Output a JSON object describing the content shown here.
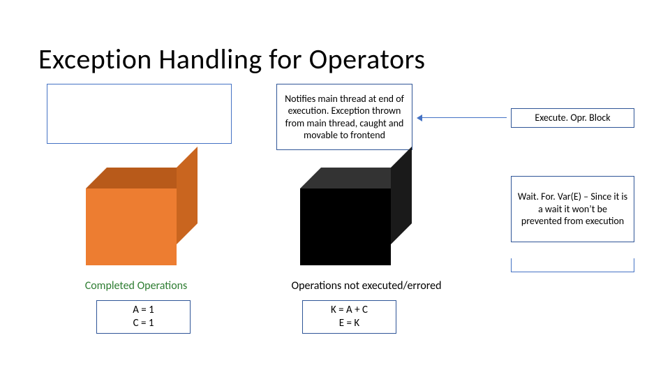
{
  "title": "Exception Handling for Operators",
  "notifies": "Notifies main thread at end of execution. Exception thrown from main thread, caught and movable to frontend",
  "execute": "Execute. Opr. Block",
  "wait": "Wait. For. Var(E) – Since it is a wait it won’t be prevented from execution",
  "labels": {
    "completed": "Completed Operations",
    "notexec": "Operations not executed/errored"
  },
  "code": {
    "ac_line1": "A = 1",
    "ac_line2": "C = 1",
    "ke_line1": "K = A + C",
    "ke_line2": "E = K"
  }
}
